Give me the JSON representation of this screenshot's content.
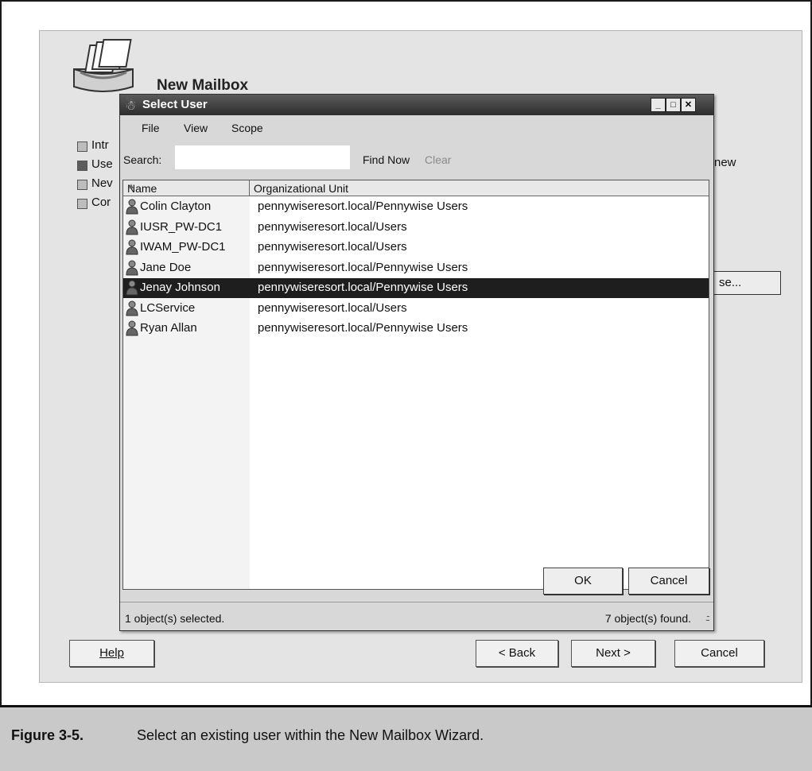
{
  "wizard": {
    "title": "New Mailbox",
    "steps": [
      {
        "label": "Intr",
        "active": false
      },
      {
        "label": "Use",
        "active": true
      },
      {
        "label": "Nev",
        "active": false
      },
      {
        "label": "Cor",
        "active": false
      }
    ],
    "right_text": "new",
    "browse_label": "se...",
    "help_label": "Help",
    "back_label": "< Back",
    "next_label": "Next >",
    "cancel_label": "Cancel"
  },
  "dialog": {
    "title": "Select User",
    "menu": [
      "File",
      "View",
      "Scope"
    ],
    "search_label": "Search:",
    "search_value": "",
    "find_now_label": "Find Now",
    "clear_label": "Clear",
    "columns": [
      "Name",
      "Organizational Unit"
    ],
    "rows": [
      {
        "name": "Colin Clayton",
        "ou": "pennywiseresort.local/Pennywise Users"
      },
      {
        "name": "IUSR_PW-DC1",
        "ou": "pennywiseresort.local/Users"
      },
      {
        "name": "IWAM_PW-DC1",
        "ou": "pennywiseresort.local/Users"
      },
      {
        "name": "Jane Doe",
        "ou": "pennywiseresort.local/Pennywise Users"
      },
      {
        "name": "Jenay Johnson",
        "ou": "pennywiseresort.local/Pennywise Users",
        "selected": true
      },
      {
        "name": "LCService",
        "ou": "pennywiseresort.local/Users"
      },
      {
        "name": "Ryan Allan",
        "ou": "pennywiseresort.local/Pennywise Users"
      }
    ],
    "ok_label": "OK",
    "cancel_label": "Cancel",
    "status_left": "1 object(s) selected.",
    "status_right": "7 object(s) found."
  },
  "caption": {
    "label": "Figure 3-5.",
    "text": "Select an existing user within the New Mailbox Wizard."
  },
  "colors": {
    "selection": "#1e1e1e",
    "titlebar": "#3a3a3a",
    "caption_bg": "#c9c9c9"
  }
}
